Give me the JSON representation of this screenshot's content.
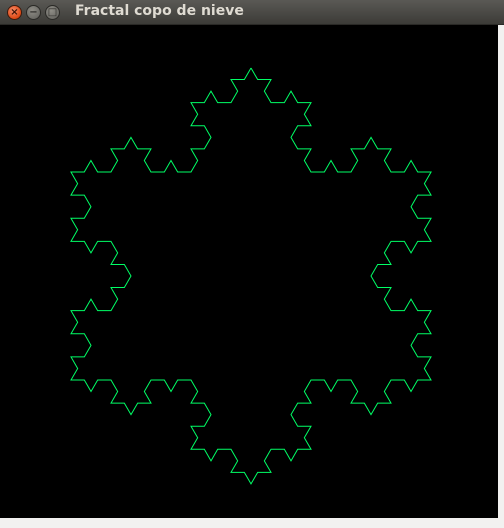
{
  "window": {
    "title": "Fractal copo de nieve",
    "close_glyph": "×",
    "minimize_glyph": "−",
    "maximize_glyph": "□"
  },
  "drawing": {
    "shape": "koch-snowflake",
    "iterations": 3,
    "stroke_color": "#00ff66",
    "background_color": "#000000"
  }
}
